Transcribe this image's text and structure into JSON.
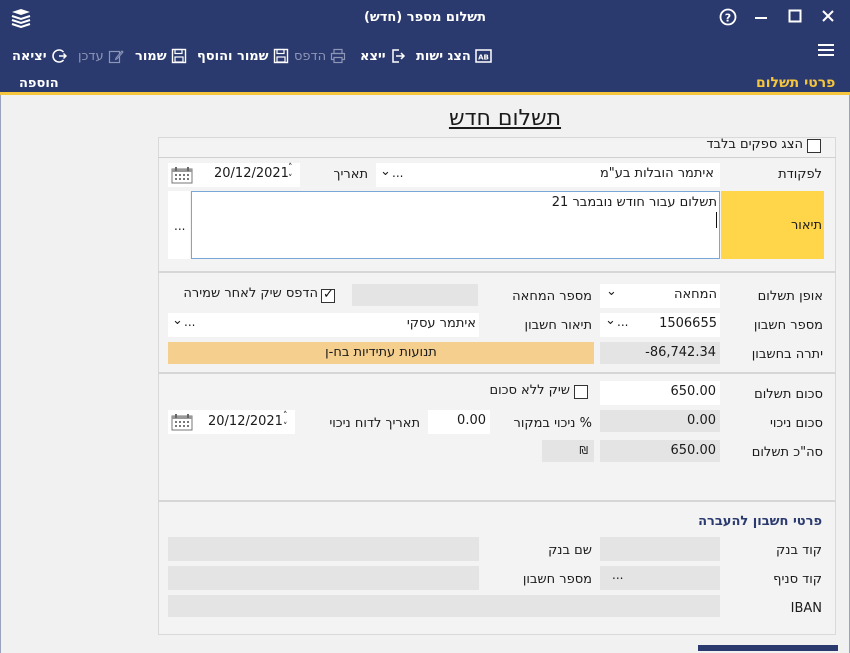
{
  "window": {
    "title": "תשלום מספר (חדש)",
    "help_icon": "help-circle-icon",
    "minimize_icon": "minimize-icon",
    "maximize_icon": "maximize-icon",
    "close_icon": "close-icon"
  },
  "toolbar": {
    "show_entities": "הצג ישות",
    "exit_to": "ייצא",
    "print": "הדפס",
    "save_and_add": "שמור והוסף",
    "save": "שמור",
    "update": "עדכן",
    "exit": "יציאה"
  },
  "band": {
    "section_title": "פרטי תשלום",
    "mode": "הוספה"
  },
  "form": {
    "heading": "תשלום חדש",
    "show_suppliers_only": "הצג ספקים בלבד",
    "payee_label": "לפקודת",
    "payee_value": "איתמר הובלות בע\"מ",
    "date_label": "תאריך",
    "date_value": "20/12/2021",
    "description_label": "תיאור",
    "description_value": "תשלום עבור חודש נובמבר 21",
    "ellipsis": "...",
    "payment_method_label": "אופן תשלום",
    "payment_method_value": "המחאה",
    "check_number_label": "מספר המחאה",
    "check_number_value": "",
    "print_check_label": "הדפס שיק לאחר שמירה",
    "account_number_label": "מספר חשבון",
    "account_number_value": "1506655",
    "account_desc_label": "תיאור חשבון",
    "account_desc_value": "איתמר עסקי",
    "balance_label": "יתרה בחשבון",
    "balance_value": "-86,742.34",
    "future_transactions": "תנועות עתידיות בח-ן",
    "amount_label": "סכום תשלום",
    "amount_value": "650.00",
    "check_no_amount_label": "שיק ללא סכום",
    "deduction_label": "סכום ניכוי",
    "deduction_value": "0.00",
    "withholding_pct_label": "% ניכוי במקור",
    "withholding_pct_value": "0.00",
    "deduction_report_date_label": "תאריך לדוח ניכוי",
    "deduction_report_date_value": "20/12/2021",
    "total_label": "סה\"כ תשלום",
    "total_value": "650.00",
    "currency_symbol": "₪"
  },
  "transfer": {
    "section_title": "פרטי חשבון להעברה",
    "bank_code_label": "קוד בנק",
    "bank_name_label": "שם בנק",
    "branch_code_label": "קוד סניף",
    "account_number_label": "מספר חשבון",
    "iban_label": "IBAN",
    "branch_ellipsis": "..."
  },
  "colors": {
    "header": "#2b3a6e",
    "accent": "#f4c53d",
    "highlight_label": "#ffd64a",
    "future_bar": "#f5cf8e"
  }
}
